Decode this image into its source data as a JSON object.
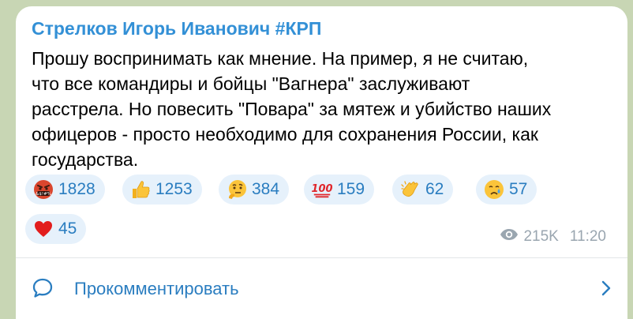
{
  "post": {
    "author": "Стрелков Игорь Иванович #КРП",
    "lines": [
      "Прошу воспринимать как мнение. На пример, я не считаю,",
      "что все командиры и бойцы \"Вагнера\" заслуживают",
      "расстрела. Но повесить \"Повара\" за мятеж и убийство наших",
      "офицеров - просто необходимо для сохранения России, как",
      "государства."
    ]
  },
  "reactions": [
    {
      "icon": "cursing-face-icon",
      "count": "1828"
    },
    {
      "icon": "thumbs-up-icon",
      "count": "1253"
    },
    {
      "icon": "thinking-face-icon",
      "count": "384"
    },
    {
      "icon": "hundred-points-icon",
      "count": "159"
    },
    {
      "icon": "clapping-hands-icon",
      "count": "62"
    },
    {
      "icon": "crying-face-icon",
      "count": "57"
    },
    {
      "icon": "red-heart-icon",
      "count": "45"
    }
  ],
  "meta": {
    "views": "215K",
    "time": "11:20"
  },
  "comment": {
    "label": "Прокомментировать"
  },
  "colors": {
    "accent": "#3390d6",
    "chip_bg": "#e6f1fb",
    "background": "#c8d6b4"
  }
}
